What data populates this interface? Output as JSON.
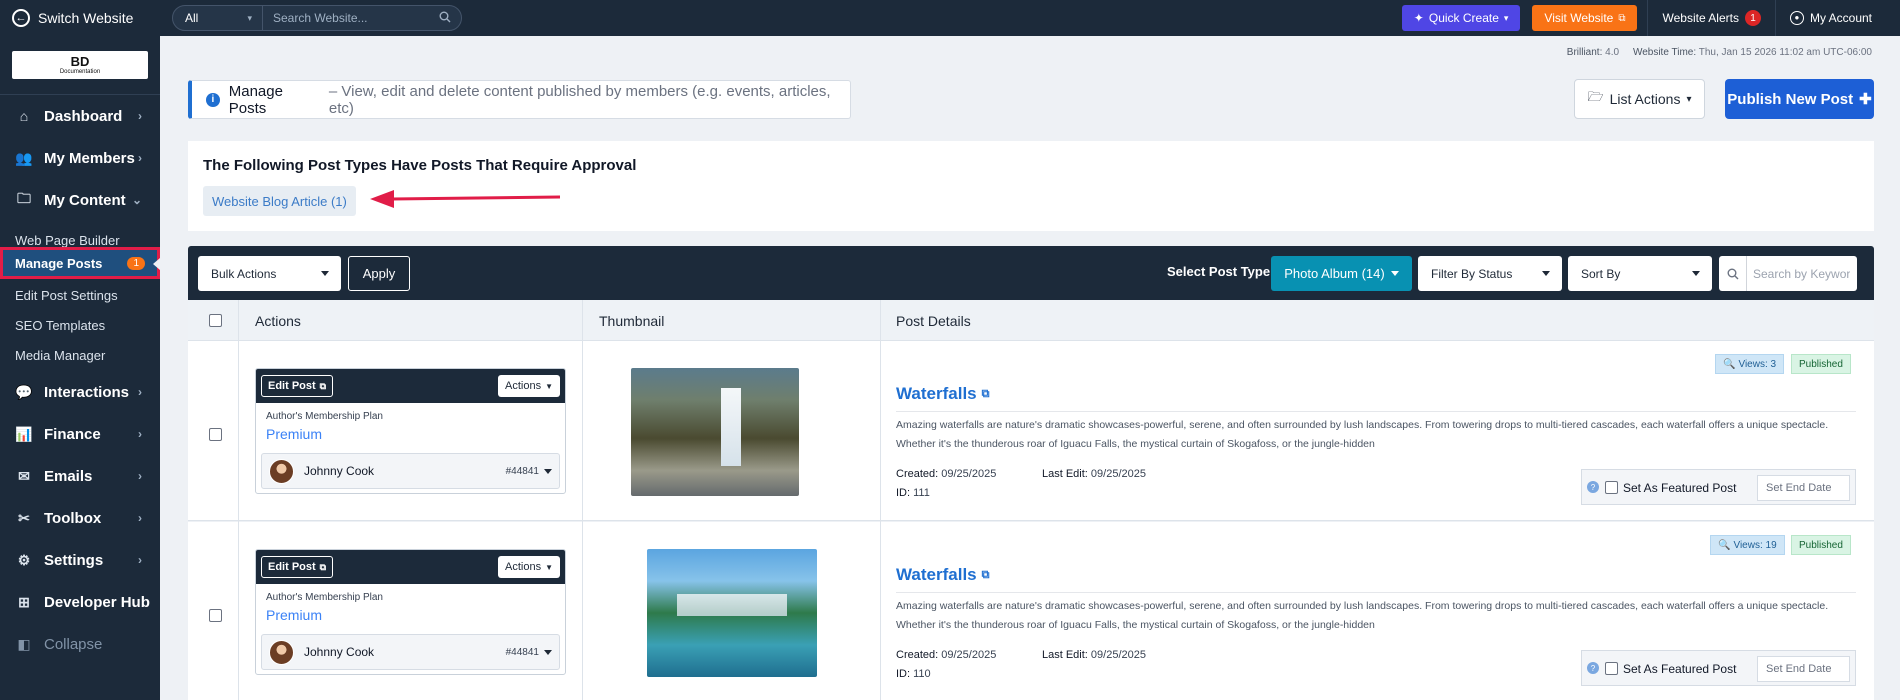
{
  "topbar": {
    "switch_label": "Switch Website",
    "scope_value": "All",
    "search_placeholder": "Search Website...",
    "quick_create": "Quick Create",
    "visit_website": "Visit Website",
    "alerts_label": "Website Alerts",
    "alerts_count": "1",
    "account_label": "My Account"
  },
  "sidebar": {
    "logo_main": "BD",
    "logo_sub": "Documentation",
    "nav": {
      "dashboard": "Dashboard",
      "members": "My Members",
      "content": "My Content",
      "interactions": "Interactions",
      "finance": "Finance",
      "emails": "Emails",
      "toolbox": "Toolbox",
      "settings": "Settings",
      "developer": "Developer Hub",
      "collapse": "Collapse"
    },
    "subnav": {
      "web_page_builder": "Web Page Builder",
      "manage_posts": "Manage Posts",
      "manage_posts_count": "1",
      "edit_post_settings": "Edit Post Settings",
      "seo_templates": "SEO Templates",
      "media_manager": "Media Manager"
    }
  },
  "meta": {
    "version_label": "Brilliant:",
    "version_value": "4.0",
    "time_label": "Website Time:",
    "time_value": "Thu, Jan 15 2026 11:02 am UTC-06:00"
  },
  "info": {
    "title": "Manage Posts",
    "description": "– View, edit and delete content published by members (e.g. events, articles, etc)"
  },
  "buttons": {
    "list_actions": "List Actions",
    "publish": "Publish New Post"
  },
  "approval": {
    "heading": "The Following Post Types Have Posts That Require Approval",
    "pill": "Website Blog Article (1)"
  },
  "toolbar": {
    "bulk_actions": "Bulk Actions",
    "apply": "Apply",
    "post_type_label": "Select Post Type:",
    "post_type_value": "Photo Album (14)",
    "filter_status": "Filter By Status",
    "sort_by": "Sort By",
    "keyword_placeholder": "Search by Keywor"
  },
  "table": {
    "headers": {
      "actions": "Actions",
      "thumbnail": "Thumbnail",
      "details": "Post Details"
    },
    "rows": [
      {
        "edit_label": "Edit Post",
        "actions_label": "Actions",
        "plan_label": "Author's Membership Plan",
        "plan_value": "Premium",
        "author_name": "Johnny Cook",
        "author_id": "#44841",
        "title": "Waterfalls",
        "views": "Views: 3",
        "status": "Published",
        "description": "Amazing waterfalls are nature's dramatic showcases-powerful, serene, and often surrounded by lush landscapes. From towering drops to multi-tiered cascades, each waterfall offers a unique spectacle. Whether it's the thunderous roar of Iguacu Falls, the mystical curtain of Skogafoss, or the jungle-hidden",
        "created_label": "Created:",
        "created_value": "09/25/2025",
        "edited_label": "Last Edit:",
        "edited_value": "09/25/2025",
        "id_label": "ID:",
        "id_value": "111",
        "featured_label": "Set As Featured Post",
        "end_date_placeholder": "Set End Date"
      },
      {
        "edit_label": "Edit Post",
        "actions_label": "Actions",
        "plan_label": "Author's Membership Plan",
        "plan_value": "Premium",
        "author_name": "Johnny Cook",
        "author_id": "#44841",
        "title": "Waterfalls",
        "views": "Views: 19",
        "status": "Published",
        "description": "Amazing waterfalls are nature's dramatic showcases-powerful, serene, and often surrounded by lush landscapes. From towering drops to multi-tiered cascades, each waterfall offers a unique spectacle. Whether it's the thunderous roar of Iguacu Falls, the mystical curtain of Skogafoss, or the jungle-hidden",
        "created_label": "Created:",
        "created_value": "09/25/2025",
        "edited_label": "Last Edit:",
        "edited_value": "09/25/2025",
        "id_label": "ID:",
        "id_value": "110",
        "featured_label": "Set As Featured Post",
        "end_date_placeholder": "Set End Date"
      }
    ]
  },
  "colors": {
    "sidebar_bg": "#1c2a3a",
    "primary": "#1d5fd6",
    "quick_create": "#4f46e5",
    "visit_website": "#f97316",
    "post_type_button": "#0891b2",
    "highlight": "#e11d48"
  }
}
